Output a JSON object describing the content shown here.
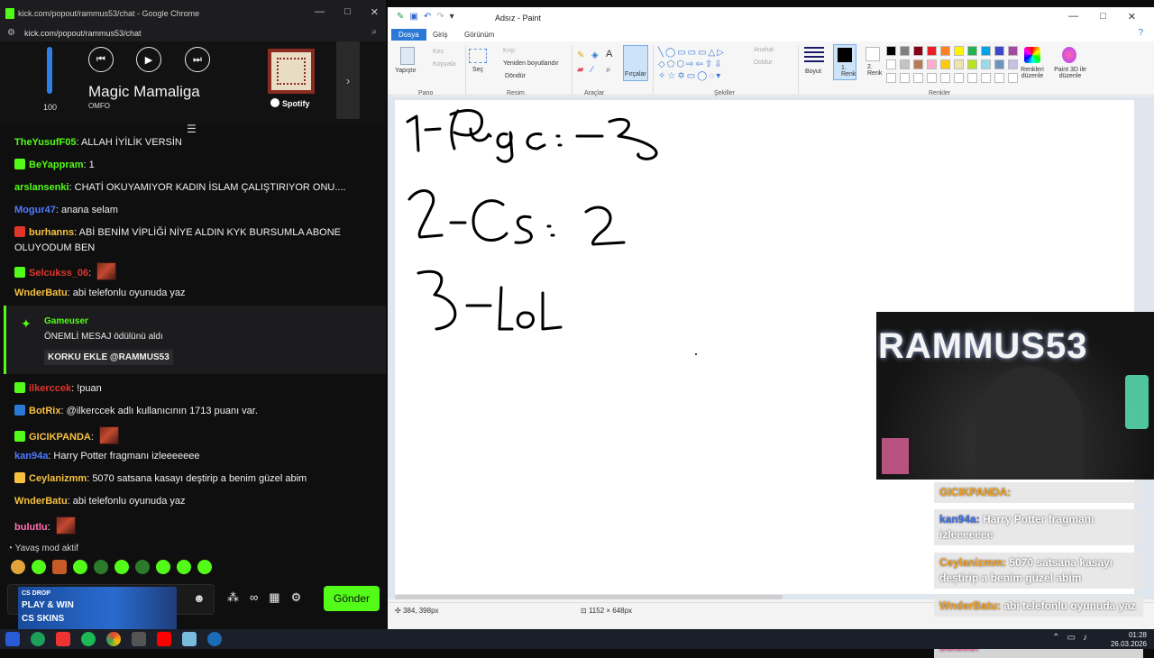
{
  "chrome": {
    "title": "kick.com/popout/rammus53/chat - Google Chrome",
    "url": "kick.com/popout/rammus53/chat",
    "win_min": "—",
    "win_max": "□",
    "win_close": "✕"
  },
  "spotify": {
    "volume": "100",
    "volume_fraction": 1.0,
    "track": "Magic Mamaliga",
    "artist": "OMFO",
    "brand": "Spotify",
    "prev": "⏮",
    "play": "▶",
    "next": "⏭",
    "more_arrow": "›",
    "collapse_icon": "☰"
  },
  "chat": {
    "messages": [
      {
        "user": "TheYusufF05",
        "color": "#53fc18",
        "text": ": ALLAH İYİLİK VERSİN"
      },
      {
        "user": "BeYappram",
        "color": "#53fc18",
        "text": ": 1"
      },
      {
        "user": "arslansenki",
        "color": "#53fc18",
        "text": ": CHATİ OKUYAMIYOR KADIN İSLAM ÇALIŞTIRIYOR ONU...."
      },
      {
        "user": "Mogur47",
        "color": "#4f7bff",
        "text": ": anana selam"
      },
      {
        "user": "burhanns",
        "color": "#f6c23e",
        "text": ": ABİ BENİM VİPLİĞİ NİYE ALDIN KYK BURSUMLA ABONE"
      },
      {
        "user": "",
        "color": "#fff",
        "text": "OLUYODUM BEN"
      },
      {
        "user": "Selcukss_06",
        "color": "#e0352b",
        "text": ":"
      },
      {
        "user": "WnderBatu",
        "color": "#f6c23e",
        "text": ": abi telefonlu oyunuda yaz"
      },
      {
        "user": "ilkerccek",
        "color": "#e0352b",
        "text": ": !puan"
      },
      {
        "user": "BotRix",
        "color": "#f6c23e",
        "text": ": @ilkerccek adlı kullanıcının 1713 puanı var."
      },
      {
        "user": "GICIKPANDA",
        "color": "#f6c23e",
        "text": ":"
      },
      {
        "user": "kan94a",
        "color": "#4f7bff",
        "text": ": Harry Potter fragmanı izleeeeeee"
      },
      {
        "user": "Ceylanizmm",
        "color": "#f6c23e",
        "text": ": 5070 satsana kasayı deştirip a benim güzel abim"
      },
      {
        "user": "WnderBatu",
        "color": "#f6c23e",
        "text": ": abi telefonlu oyunuda yaz"
      },
      {
        "user": "bulutlu",
        "color": "#ff6fb0",
        "text": ":"
      }
    ],
    "pinned": {
      "user": "Gameuser",
      "line": "ÖNEMLİ MESAJ ödülünü aldı",
      "reward": "KORKU EKLE @RAMMUS53"
    },
    "slow_mode": "Yavaş mod aktif",
    "send_label": "Gönder",
    "ad": {
      "brand": "CS DROP",
      "line1": "PLAY & WIN",
      "line2": "CS SKINS"
    }
  },
  "paint": {
    "title": "Adsız - Paint",
    "tabs": [
      "Dosya",
      "Giriş",
      "Görünüm"
    ],
    "groups": {
      "pano": "Pano",
      "resim": "Resim",
      "araclar": "Araçlar",
      "sekiller": "Şekiller",
      "renkler": "Renkler"
    },
    "buttons": {
      "paste": "Yapıştır",
      "cut": "Kes",
      "copy": "Kopyala",
      "select": "Seç",
      "crop": "Kırp",
      "resize": "Yeniden boyutlandır",
      "rotate": "Döndür",
      "brushes": "Fırçalar",
      "outline": "Anahat",
      "fill": "Doldur",
      "size": "Boyut",
      "color1": "1.\nRenk",
      "color2": "2.\nRenk",
      "edit_colors": "Renkleri düzenle",
      "paint3d": "Paint 3D ile düzenle"
    },
    "status_pos": "384, 398px",
    "status_size": "1152 × 648px",
    "palette": [
      "#000000",
      "#7f7f7f",
      "#880015",
      "#ed1c24",
      "#ff7f27",
      "#fff200",
      "#22b14c",
      "#00a2e8",
      "#3f48cc",
      "#a349a4",
      "#ffffff",
      "#c3c3c3",
      "#b97a57",
      "#ffaec9",
      "#ffc90e",
      "#efe4b0",
      "#b5e61d",
      "#99d9ea",
      "#7092be",
      "#c8bfe7"
    ]
  },
  "stream": {
    "cam_name": "RAMMUS53",
    "overlay": [
      {
        "user": "GICIKPANDA:",
        "color": "#f6a21e",
        "text": ""
      },
      {
        "user": "kan94a:",
        "color": "#3b6fe6",
        "text": "Harry Potter fragmanı izleeeeeee"
      },
      {
        "user": "Ceylanizmm:",
        "color": "#f6a21e",
        "text": "5070 satsana kasayı deştirip a benim güzel abim"
      },
      {
        "user": "WnderBatu:",
        "color": "#f6a21e",
        "text": "abi telefonlu oyunuda yaz"
      },
      {
        "user": "bulutlu:",
        "color": "#ff6fb0",
        "text": ""
      }
    ]
  },
  "taskbar": {
    "time": "01:28",
    "date": "26.03.2026"
  }
}
